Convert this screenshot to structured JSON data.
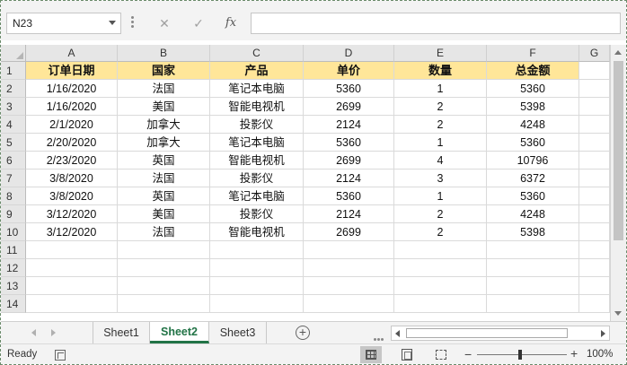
{
  "formula_bar": {
    "name_box": "N23",
    "cancel_glyph": "✕",
    "enter_glyph": "✓",
    "fx_label": "fx",
    "formula": ""
  },
  "columns": [
    "A",
    "B",
    "C",
    "D",
    "E",
    "F",
    "G"
  ],
  "rows": [
    "1",
    "2",
    "3",
    "4",
    "5",
    "6",
    "7",
    "8",
    "9",
    "10",
    "11",
    "12",
    "13",
    "14"
  ],
  "table": {
    "header": [
      "订单日期",
      "国家",
      "产品",
      "单价",
      "数量",
      "总金额"
    ],
    "body": [
      [
        "1/16/2020",
        "法国",
        "笔记本电脑",
        "5360",
        "1",
        "5360"
      ],
      [
        "1/16/2020",
        "美国",
        "智能电视机",
        "2699",
        "2",
        "5398"
      ],
      [
        "2/1/2020",
        "加拿大",
        "投影仪",
        "2124",
        "2",
        "4248"
      ],
      [
        "2/20/2020",
        "加拿大",
        "笔记本电脑",
        "5360",
        "1",
        "5360"
      ],
      [
        "2/23/2020",
        "英国",
        "智能电视机",
        "2699",
        "4",
        "10796"
      ],
      [
        "3/8/2020",
        "法国",
        "投影仪",
        "2124",
        "3",
        "6372"
      ],
      [
        "3/8/2020",
        "英国",
        "笔记本电脑",
        "5360",
        "1",
        "5360"
      ],
      [
        "3/12/2020",
        "美国",
        "投影仪",
        "2124",
        "2",
        "4248"
      ],
      [
        "3/12/2020",
        "法国",
        "智能电视机",
        "2699",
        "2",
        "5398"
      ]
    ]
  },
  "sheets": {
    "tabs": [
      "Sheet1",
      "Sheet2",
      "Sheet3"
    ],
    "active": "Sheet2",
    "add_glyph": "+"
  },
  "status_bar": {
    "ready": "Ready",
    "zoom": "100%",
    "zoom_minus": "−",
    "zoom_plus": "+"
  },
  "colors": {
    "header_fill": "#ffe699",
    "accent_green": "#217346"
  },
  "icons": {
    "macro": "macro-record-icon",
    "normal_view": "grid-view-icon",
    "page_layout": "page-layout-icon",
    "page_break": "page-break-icon"
  }
}
